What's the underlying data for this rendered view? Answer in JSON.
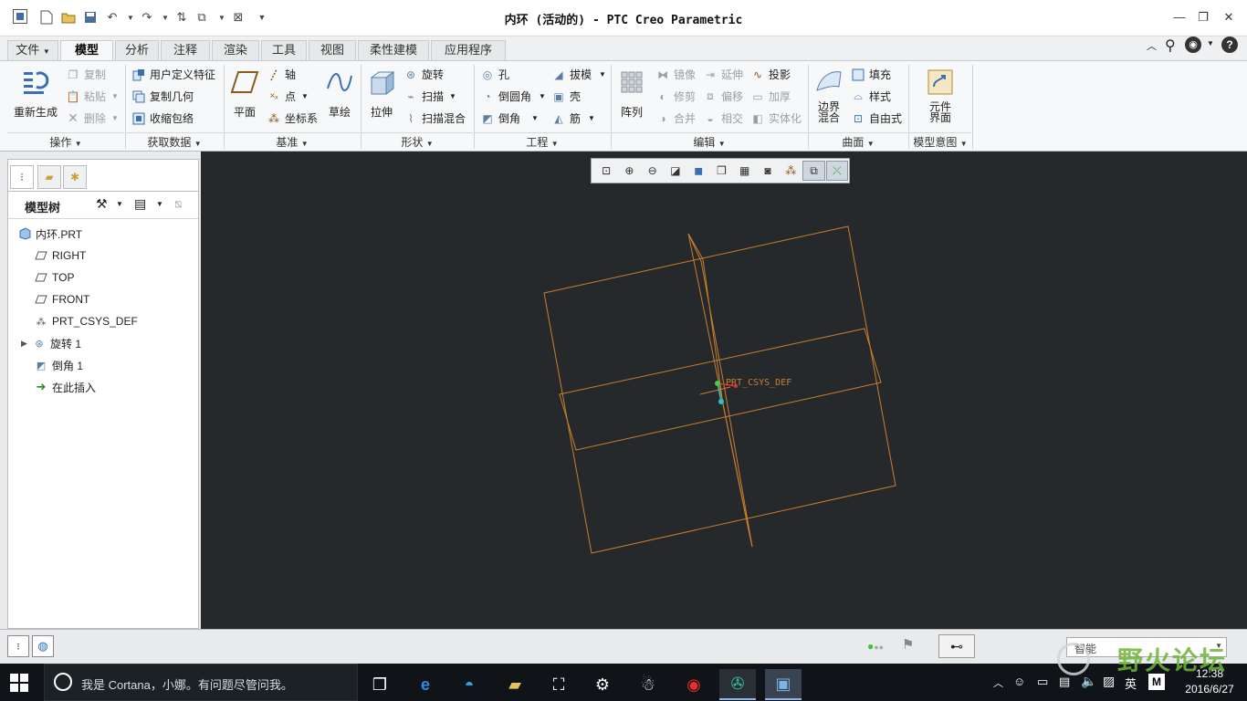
{
  "window": {
    "title": "内环 (活动的) - PTC Creo Parametric"
  },
  "tabs": [
    {
      "label": "文件",
      "has_dropdown": true
    },
    {
      "label": "模型",
      "active": true
    },
    {
      "label": "分析"
    },
    {
      "label": "注释"
    },
    {
      "label": "渲染"
    },
    {
      "label": "工具"
    },
    {
      "label": "视图"
    },
    {
      "label": "柔性建模"
    },
    {
      "label": "应用程序"
    }
  ],
  "ribbon": {
    "groups": {
      "operations": {
        "label": "操作",
        "regenerate": "重新生成",
        "copy": "复制",
        "paste": "粘贴",
        "delete": "删除"
      },
      "get_data": {
        "label": "获取数据",
        "udf": "用户定义特征",
        "copy_geom": "复制几何",
        "shrinkwrap": "收缩包络"
      },
      "datum": {
        "label": "基准",
        "plane": "平面",
        "axis": "轴",
        "point": "点",
        "csys": "坐标系",
        "sketch": "草绘"
      },
      "shapes": {
        "label": "形状",
        "extrude": "拉伸",
        "revolve": "旋转",
        "sweep": "扫描",
        "swept_blend": "扫描混合"
      },
      "engineering": {
        "label": "工程",
        "hole": "孔",
        "round": "倒圆角",
        "chamfer": "倒角",
        "draft": "拔模",
        "shell": "壳",
        "rib": "筋"
      },
      "editing": {
        "label": "编辑",
        "pattern": "阵列",
        "mirror": "镜像",
        "trim": "修剪",
        "merge": "合并",
        "extend": "延伸",
        "offset": "偏移",
        "intersect": "相交",
        "project": "投影",
        "thicken": "加厚",
        "solidify": "实体化"
      },
      "surfaces": {
        "label": "曲面",
        "boundary_blend_1": "边界",
        "boundary_blend_2": "混合",
        "fill": "填充",
        "style": "样式",
        "freestyle": "自由式"
      },
      "model_intent": {
        "label": "模型意图",
        "component_interface_1": "元件",
        "component_interface_2": "界面"
      }
    }
  },
  "model_tree": {
    "header": "模型树",
    "items": [
      {
        "label": "内环.PRT",
        "icon": "part-icon"
      },
      {
        "label": "RIGHT",
        "icon": "datum-plane-icon"
      },
      {
        "label": "TOP",
        "icon": "datum-plane-icon"
      },
      {
        "label": "FRONT",
        "icon": "datum-plane-icon"
      },
      {
        "label": "PRT_CSYS_DEF",
        "icon": "csys-icon"
      },
      {
        "label": "旋转 1",
        "icon": "revolve-icon",
        "expandable": true
      },
      {
        "label": "倒角 1",
        "icon": "chamfer-icon"
      },
      {
        "label": "在此插入",
        "icon": "insert-here-arrow-icon"
      }
    ]
  },
  "graphics": {
    "csys_label": "PRT_CSYS_DEF",
    "colors": {
      "background": "#26292b",
      "datum": "#c87f2e"
    }
  },
  "status": {
    "filter_value": "智能"
  },
  "taskbar": {
    "search_placeholder": "我是 Cortana，小娜。有问题尽管问我。",
    "ime": "英",
    "time": "12:38",
    "date": "2016/6/27"
  },
  "watermark": "野火论坛"
}
